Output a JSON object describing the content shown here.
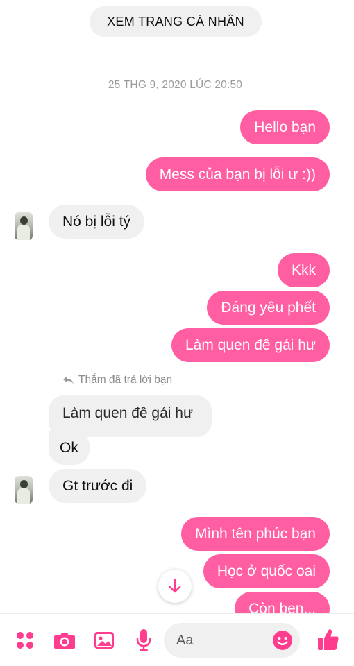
{
  "header": {
    "view_profile_label": "XEM TRANG CÁ NHÂN"
  },
  "conversation": {
    "timestamp": "25 THG 9, 2020 LÚC 20:50",
    "reply_note": "Thắm đã trả lời bạn",
    "messages": [
      {
        "sender": "me",
        "text": "Hello bạn"
      },
      {
        "sender": "me",
        "text": "Mess của bạn bị lỗi ư :))"
      },
      {
        "sender": "them",
        "text": "Nó bị lỗi tý"
      },
      {
        "sender": "me",
        "text": "Kkk"
      },
      {
        "sender": "me",
        "text": "Đáng yêu phết"
      },
      {
        "sender": "me",
        "text": "Làm quen đê gái hư"
      },
      {
        "sender": "them",
        "text": "Làm quen đê gái hư",
        "quoted": true
      },
      {
        "sender": "them",
        "text": "Ok"
      },
      {
        "sender": "them",
        "text": "Gt trước đi"
      },
      {
        "sender": "me",
        "text": "Mình tên phúc bạn"
      },
      {
        "sender": "me",
        "text": "Học ở quốc oai"
      },
      {
        "sender": "me",
        "text": "Còn ben..."
      }
    ]
  },
  "composer": {
    "input_placeholder": "Aa",
    "icons": [
      "apps-icon",
      "camera-icon",
      "image-icon",
      "microphone-icon",
      "emoji-icon",
      "thumbs-up-icon"
    ]
  },
  "colors": {
    "outgoing_bubble": "#ff5fa2",
    "incoming_bubble": "#f0f0f0",
    "accent_icons": "#ff3d8f"
  }
}
